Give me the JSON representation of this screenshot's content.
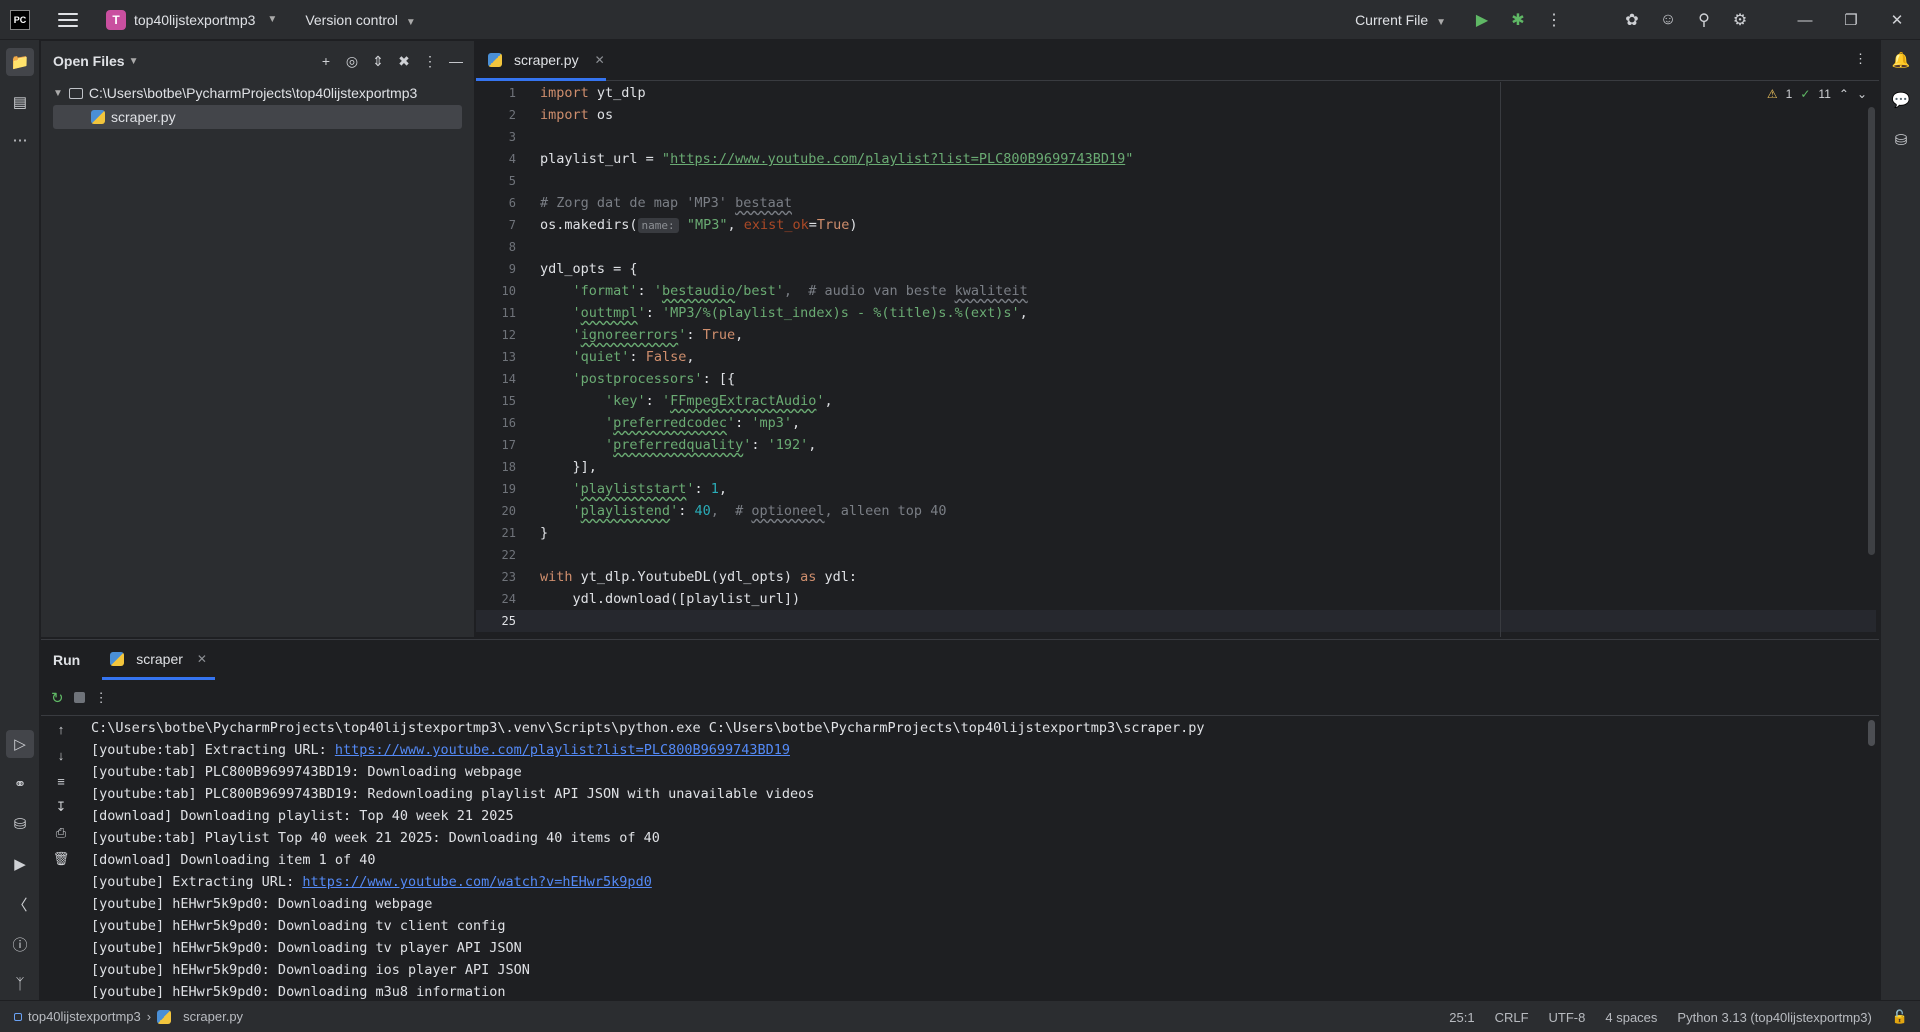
{
  "titlebar": {
    "logo_text": "PC",
    "project_badge": "T",
    "project_name": "top40lijstexportmp3",
    "version_control": "Version control",
    "run_config": "Current File",
    "icons": [
      "hamburger-icon",
      "run-icon",
      "debug-icon",
      "more-icon",
      "ai-icon",
      "add-user-icon",
      "search-icon",
      "settings-icon"
    ],
    "window_controls": [
      "minimize",
      "restore",
      "close"
    ]
  },
  "project_panel": {
    "title": "Open Files",
    "root_path": "C:\\Users\\botbe\\PycharmProjects\\top40lijstexportmp3",
    "file": "scraper.py"
  },
  "editor": {
    "tab_label": "scraper.py",
    "inspections": {
      "warnings": "1",
      "checks": "11"
    },
    "line_numbers": [
      "1",
      "2",
      "3",
      "4",
      "5",
      "6",
      "7",
      "8",
      "9",
      "10",
      "11",
      "12",
      "13",
      "14",
      "15",
      "16",
      "17",
      "18",
      "19",
      "20",
      "21",
      "22",
      "23",
      "24",
      "25"
    ],
    "tokens": {
      "l1_kw": "import",
      "l1_txt": " yt_dlp",
      "l2_kw": "import",
      "l2_txt": " os",
      "l4_a": "playlist_url = ",
      "l4_q1": "\"",
      "l4_url": "https://www.youtube.com/playlist?list=PLC800B9699743BD19",
      "l4_q2": "\"",
      "l6_a": "# Zorg dat de map 'MP3' ",
      "l6_b": "bestaat",
      "l7_a": "os.makedirs(",
      "l7_hint": "name:",
      "l7_str": "\"MP3\"",
      "l7_comma": ", ",
      "l7_param": "exist_ok",
      "l7_eq": "=",
      "l7_true": "True",
      "l7_close": ")",
      "l9": "ydl_opts = {",
      "l10_k": "'format'",
      "l10_sep": ": ",
      "l10_v1": "'",
      "l10_vw": "bestaudio",
      "l10_v2": "/best'",
      "l10_c": ",  # audio van beste ",
      "l10_cw": "kwaliteit",
      "l11_k1": "'",
      "l11_kw": "outtmpl",
      "l11_k2": "'",
      "l11_sep": ": ",
      "l11_v": "'MP3/%(playlist_index)s - %(title)s.%(ext)s'",
      "l11_end": ",",
      "l12_k1": "'",
      "l12_kw": "ignoreerrors",
      "l12_k2": "'",
      "l12_sep": ": ",
      "l12_v": "True",
      "l12_end": ",",
      "l13_k": "'quiet'",
      "l13_sep": ": ",
      "l13_v": "False",
      "l13_end": ",",
      "l14_k": "'postprocessors'",
      "l14_sep": ": [{",
      "l15_k": "'key'",
      "l15_sep": ": ",
      "l15_v1": "'",
      "l15_vw": "FFmpegExtractAudio",
      "l15_v2": "'",
      "l15_end": ",",
      "l16_k1": "'",
      "l16_kw": "preferredcodec",
      "l16_k2": "'",
      "l16_sep": ": ",
      "l16_v": "'mp3'",
      "l16_end": ",",
      "l17_k1": "'",
      "l17_kw": "preferredquality",
      "l17_k2": "'",
      "l17_sep": ": ",
      "l17_v": "'192'",
      "l17_end": ",",
      "l18": "}],",
      "l19_k1": "'",
      "l19_kw": "playliststart",
      "l19_k2": "'",
      "l19_sep": ": ",
      "l19_v": "1",
      "l19_end": ",",
      "l20_k1": "'",
      "l20_kw": "playlistend",
      "l20_k2": "'",
      "l20_sep": ": ",
      "l20_v": "40",
      "l20_c1": ",  # ",
      "l20_cw": "optioneel",
      "l20_c2": ", alleen top 40",
      "l21": "}",
      "l23_kw1": "with",
      "l23_a": " yt_dlp.YoutubeDL(ydl_opts) ",
      "l23_kw2": "as",
      "l23_b": " ydl:",
      "l24": "ydl.download([playlist_url])"
    }
  },
  "run_panel": {
    "title": "Run",
    "tab_label": "scraper",
    "console": {
      "c1": "C:\\Users\\botbe\\PycharmProjects\\top40lijstexportmp3\\.venv\\Scripts\\python.exe C:\\Users\\botbe\\PycharmProjects\\top40lijstexportmp3\\scraper.py",
      "c2_pre": "[youtube:tab] Extracting URL: ",
      "c2_link": "https://www.youtube.com/playlist?list=PLC800B9699743BD19",
      "c3": "[youtube:tab] PLC800B9699743BD19: Downloading webpage",
      "c4": "[youtube:tab] PLC800B9699743BD19: Redownloading playlist API JSON with unavailable videos",
      "c5": "[download] Downloading playlist: Top 40 week 21 2025",
      "c6": "[youtube:tab] Playlist Top 40 week 21 2025: Downloading 40 items of 40",
      "c7": "[download] Downloading item 1 of 40",
      "c8_pre": "[youtube] Extracting URL: ",
      "c8_link": "https://www.youtube.com/watch?v=hEHwr5k9pd0",
      "c9": "[youtube] hEHwr5k9pd0: Downloading webpage",
      "c10": "[youtube] hEHwr5k9pd0: Downloading tv client config",
      "c11": "[youtube] hEHwr5k9pd0: Downloading tv player API JSON",
      "c12": "[youtube] hEHwr5k9pd0: Downloading ios player API JSON",
      "c13": "[youtube] hEHwr5k9pd0: Downloading m3u8 information"
    }
  },
  "statusbar": {
    "breadcrumb_project": "top40lijstexportmp3",
    "breadcrumb_file": "scraper.py",
    "position": "25:1",
    "line_sep": "CRLF",
    "encoding": "UTF-8",
    "indent": "4 spaces",
    "interpreter": "Python 3.13 (top40lijstexportmp3)"
  },
  "colors": {
    "background": "#1e1f22",
    "panel": "#2b2d30",
    "accent": "#3574f0",
    "keyword": "#cf8e6d",
    "string": "#6aab73",
    "number": "#2aacb8",
    "comment": "#7a7e85",
    "link": "#548af7"
  }
}
